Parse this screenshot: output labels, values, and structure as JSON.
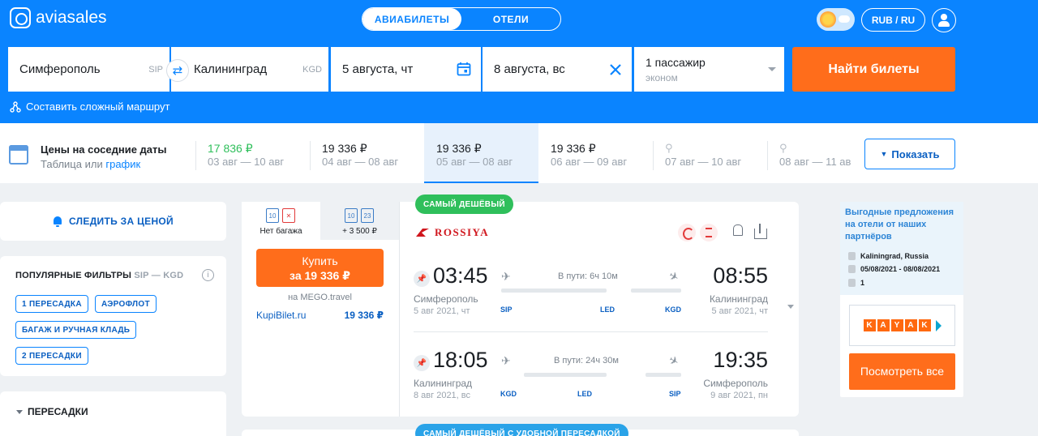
{
  "header": {
    "logo": "aviasales",
    "tabs": [
      "АВИАБИЛЕТЫ",
      "ОТЕЛИ"
    ],
    "currency": "RUB / RU"
  },
  "search": {
    "from": "Симферополь",
    "from_iata": "SIP",
    "to": "Калининград",
    "to_iata": "KGD",
    "depart": "5 августа, чт",
    "return": "8 августа, вс",
    "pax": "1 пассажир",
    "cabin": "эконом",
    "submit": "Найти билеты",
    "complex_route": "Составить сложный маршрут"
  },
  "dates": {
    "title": "Цены на соседние даты",
    "sub_table": "Таблица",
    "sub_or": "или",
    "sub_graph": "график",
    "cells": [
      {
        "price": "17 836 ₽",
        "dates": "03 авг — 10 авг"
      },
      {
        "price": "19 336 ₽",
        "dates": "04 авг — 08 авг"
      },
      {
        "price": "19 336 ₽",
        "dates": "05 авг — 08 авг"
      },
      {
        "price": "19 336 ₽",
        "dates": "06 авг — 09 авг"
      },
      {
        "price": "",
        "dates": "07 авг — 10 авг"
      },
      {
        "price": "",
        "dates": "08 авг — 11 ав"
      }
    ],
    "show_button": "Показать"
  },
  "left": {
    "follow": "СЛЕДИТЬ ЗА ЦЕНОЙ",
    "filters_title": "ПОПУЛЯРНЫЕ ФИЛЬТРЫ",
    "filters_route": "SIP — KGD",
    "chips": [
      "1 ПЕРЕСАДКА",
      "АЭРОФЛОТ",
      "БАГАЖ И РУЧНАЯ КЛАДЬ",
      "2 ПЕРЕСАДКИ"
    ],
    "transfers": "ПЕРЕСАДКИ"
  },
  "ticket": {
    "badge": "САМЫЙ ДЕШЁВЫЙ",
    "tab_no_bag": "Нет багажа",
    "tab_bag": "+ 3 500 ₽",
    "bag_small": "10",
    "bag_big": "23",
    "buy_line1": "Купить",
    "buy_line2": "за 19 336 ₽",
    "via": "на MEGO.travel",
    "alt_site": "KupiBilet.ru",
    "alt_price": "19 336 ₽",
    "airline": "ROSSIYA",
    "segments": [
      {
        "dep_time": "03:45",
        "arr_time": "08:55",
        "dep_city": "Симферополь",
        "arr_city": "Калининград",
        "dep_date": "5 авг 2021, чт",
        "arr_date": "5 авг 2021, чт",
        "duration": "В пути: 6ч 10м",
        "codes": [
          "SIP",
          "LED",
          "KGD"
        ]
      },
      {
        "dep_time": "18:05",
        "arr_time": "19:35",
        "dep_city": "Калининград",
        "arr_city": "Симферополь",
        "dep_date": "8 авг 2021, вс",
        "arr_date": "9 авг 2021, пн",
        "duration": "В пути: 24ч 30м",
        "codes": [
          "KGD",
          "LED",
          "SIP"
        ]
      }
    ],
    "badge2": "САМЫЙ ДЕШЁВЫЙ С УДОБНОЙ ПЕРЕСАДКОЙ"
  },
  "ad": {
    "title": "Выгодные предложения на отели от наших партнёров",
    "city": "Kaliningrad, Russia",
    "dates": "05/08/2021 - 08/08/2021",
    "guests": "1",
    "kayak": [
      "K",
      "A",
      "Y",
      "A",
      "K"
    ],
    "cta": "Посмотреть все"
  },
  "colors": {
    "brand": "#0a84ff",
    "accent": "#ff6d1b",
    "cheap": "#2fbf5b"
  }
}
